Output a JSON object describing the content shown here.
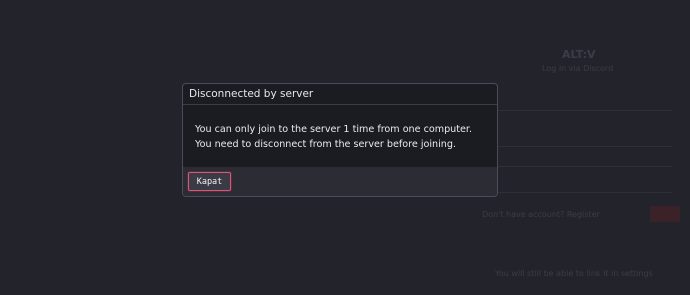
{
  "dialog": {
    "title": "Disconnected by server",
    "message": "You can only join to the server 1 time from one computer. You need to disconnect from the server before joining.",
    "close_label": "Kapat"
  },
  "background": {
    "logo": "ALT:V",
    "subtitle": "Log in via Discord",
    "register_text": "Don't have account? Register",
    "note": "You will still be able to link it in settings"
  },
  "colors": {
    "page_bg": "#23242b",
    "dialog_bg": "#1b1c22",
    "footer_bg": "#2b2c34",
    "accent": "#d05a7b"
  }
}
